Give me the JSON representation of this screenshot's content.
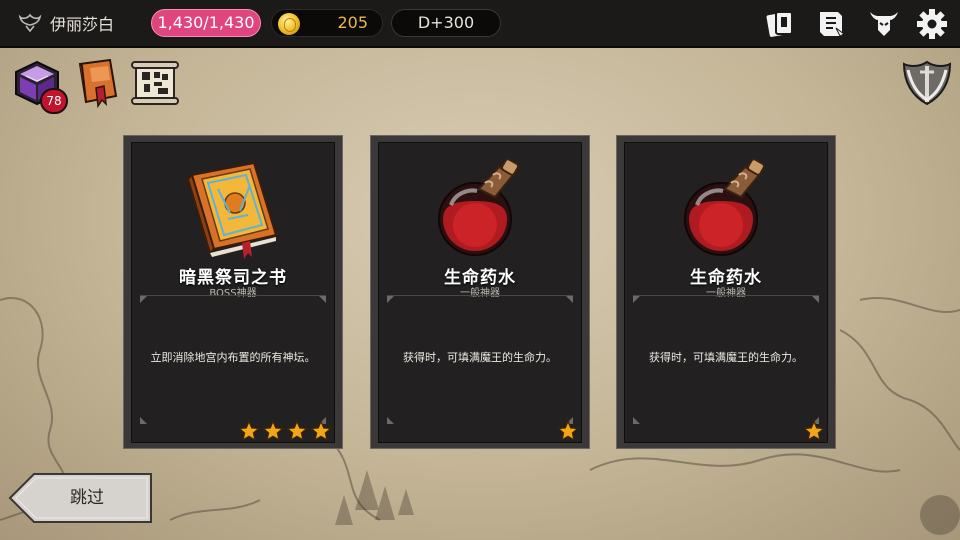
{
  "topbar": {
    "player_name": "伊丽莎白",
    "hp": "1,430/1,430",
    "gold": "205",
    "day": "D+300"
  },
  "left_icons": {
    "badge_count": "78"
  },
  "cards": [
    {
      "title": "暗黑祭司之书",
      "category": "BOSS神器",
      "description": "立即消除地宫内布置的所有神坛。",
      "stars": 4,
      "art": "book-icon"
    },
    {
      "title": "生命药水",
      "category": "一般神器",
      "description": "获得时，可填满魔王的生命力。",
      "stars": 1,
      "art": "potion-icon"
    },
    {
      "title": "生命药水",
      "category": "一般神器",
      "description": "获得时，可填满魔王的生命力。",
      "stars": 1,
      "art": "potion-icon"
    }
  ],
  "skip_label": "跳过",
  "colors": {
    "hp_pill": "#e0457e",
    "gold_text": "#e9b84a",
    "badge": "#c1142d",
    "card_bg": "#222020"
  }
}
